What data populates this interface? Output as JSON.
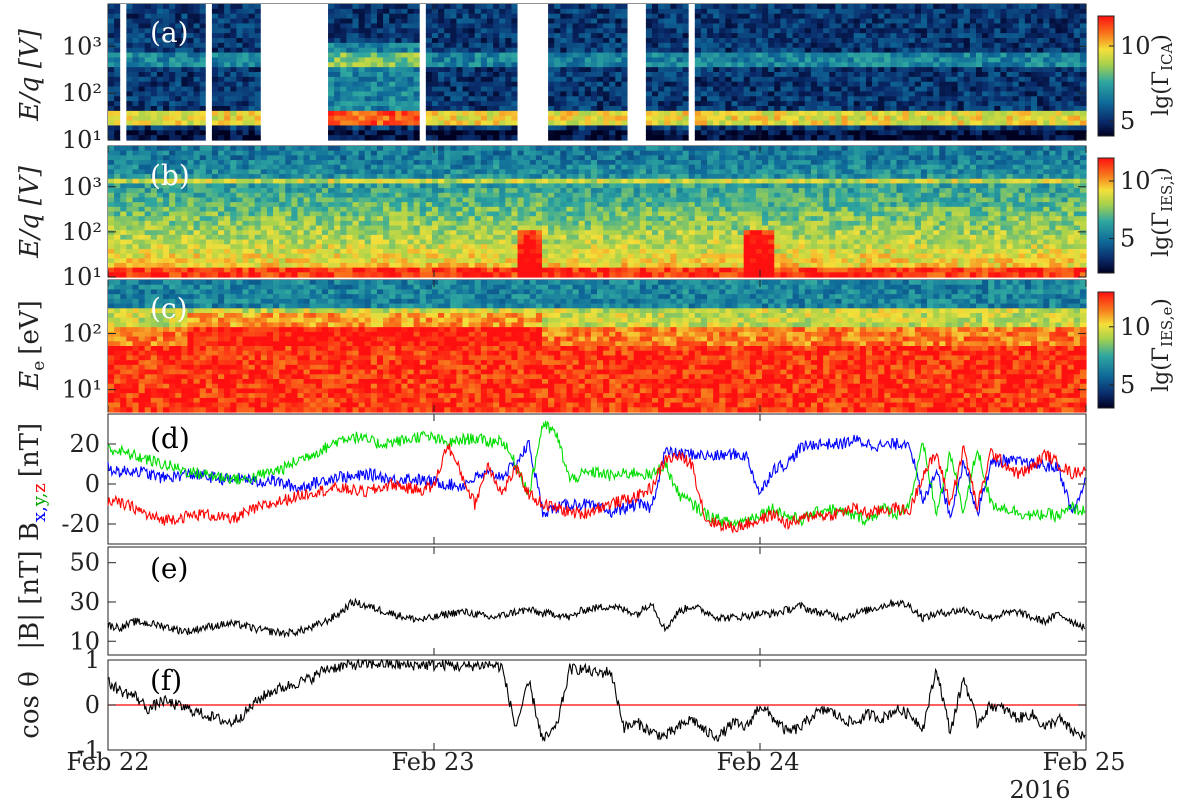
{
  "chart_data": [
    {
      "type": "heatmap",
      "panel": "(a)",
      "ylabel": "E/q [V]",
      "yscale": "log",
      "ylim": [
        10,
        8000
      ],
      "yticks": [
        "10¹",
        "10²",
        "10³"
      ],
      "colorbar": {
        "label": "lg(Γ_ICA)",
        "ticks": [
          "5",
          "10"
        ],
        "range": [
          4,
          12
        ],
        "colormap": "parula-jet"
      },
      "data_gaps_hours": [
        [
          0.8,
          1.25
        ],
        [
          7.05,
          7.5
        ],
        [
          11.2,
          16.0
        ],
        [
          23.05,
          23.3
        ],
        [
          30.0,
          32.5
        ],
        [
          38.2,
          39.4
        ],
        [
          42.6,
          43.0
        ]
      ]
    },
    {
      "type": "heatmap",
      "panel": "(b)",
      "ylabel": "E/q [V]",
      "yscale": "log",
      "ylim": [
        10,
        8000
      ],
      "yticks": [
        "10¹",
        "10²",
        "10³"
      ],
      "colorbar": {
        "label": "lg(Γ_IES,i)",
        "ticks": [
          "5",
          "10"
        ],
        "range": [
          2,
          12
        ],
        "colormap": "parula-jet"
      }
    },
    {
      "type": "heatmap",
      "panel": "(c)",
      "ylabel": "E_e [eV]",
      "yscale": "log",
      "ylim": [
        4,
        900
      ],
      "yticks": [
        "10¹",
        "10²"
      ],
      "colorbar": {
        "label": "lg(Γ_IES,e)",
        "ticks": [
          "5",
          "10"
        ],
        "range": [
          3,
          13
        ],
        "colormap": "parula-jet"
      }
    },
    {
      "type": "line",
      "panel": "(d)",
      "ylabel": "B_x,y,z [nT]",
      "ylim": [
        -30,
        35
      ],
      "yticks": [
        -20,
        0,
        20
      ],
      "series": [
        {
          "name": "x",
          "color": "#0000ff",
          "x": [
            0,
            1,
            2,
            3,
            4,
            5,
            6,
            7,
            8,
            9,
            10,
            11,
            12,
            13,
            14,
            15,
            16,
            17,
            18,
            19,
            20,
            21,
            22,
            23,
            24,
            25,
            26,
            27,
            28,
            29,
            30,
            31,
            32,
            33,
            34,
            35,
            36,
            37,
            38,
            39,
            40,
            41,
            42,
            43,
            44,
            45,
            46,
            47,
            48,
            49,
            50,
            51,
            52,
            53,
            54,
            55,
            56,
            57,
            58,
            59,
            60,
            61,
            62,
            63,
            64,
            65,
            66,
            67,
            68,
            69,
            70,
            71,
            72
          ],
          "y": [
            8,
            6,
            7,
            5,
            3,
            4,
            5,
            4,
            3,
            2,
            3,
            1,
            2,
            0,
            -2,
            0,
            2,
            4,
            3,
            5,
            4,
            2,
            3,
            2,
            1,
            0,
            -1,
            3,
            5,
            4,
            10,
            20,
            -14,
            -12,
            -10,
            -10,
            -12,
            -14,
            -12,
            -10,
            -12,
            16,
            15,
            15,
            14,
            14,
            15,
            14,
            -5,
            8,
            10,
            18,
            20,
            20,
            20,
            22,
            20,
            19,
            20,
            21,
            -10,
            8,
            -16,
            12,
            -15,
            10,
            12,
            11,
            10,
            9,
            8,
            -15,
            2
          ]
        },
        {
          "name": "y",
          "color": "#00dd00",
          "x": [
            0,
            1,
            2,
            3,
            4,
            5,
            6,
            7,
            8,
            9,
            10,
            11,
            12,
            13,
            14,
            15,
            16,
            17,
            18,
            19,
            20,
            21,
            22,
            23,
            24,
            25,
            26,
            27,
            28,
            29,
            30,
            31,
            32,
            33,
            34,
            35,
            36,
            37,
            38,
            39,
            40,
            41,
            42,
            43,
            44,
            45,
            46,
            47,
            48,
            49,
            50,
            51,
            52,
            53,
            54,
            55,
            56,
            57,
            58,
            59,
            60,
            61,
            62,
            63,
            64,
            65,
            66,
            67,
            68,
            69,
            70,
            71,
            72
          ],
          "y": [
            18,
            16,
            14,
            12,
            10,
            8,
            6,
            5,
            4,
            3,
            2,
            4,
            6,
            8,
            12,
            15,
            18,
            22,
            24,
            22,
            20,
            21,
            22,
            24,
            23,
            20,
            22,
            23,
            21,
            22,
            10,
            -5,
            30,
            25,
            2,
            5,
            6,
            4,
            5,
            6,
            4,
            10,
            -5,
            -10,
            -15,
            -18,
            -20,
            -18,
            -15,
            -12,
            -16,
            -18,
            -15,
            -12,
            -14,
            -16,
            -18,
            -12,
            -15,
            -10,
            20,
            -15,
            15,
            -14,
            18,
            -10,
            -12,
            -14,
            -16,
            -15,
            -16,
            -12,
            -14
          ]
        },
        {
          "name": "z",
          "color": "#ff0000",
          "x": [
            0,
            1,
            2,
            3,
            4,
            5,
            6,
            7,
            8,
            9,
            10,
            11,
            12,
            13,
            14,
            15,
            16,
            17,
            18,
            19,
            20,
            21,
            22,
            23,
            24,
            25,
            26,
            27,
            28,
            29,
            30,
            31,
            32,
            33,
            34,
            35,
            36,
            37,
            38,
            39,
            40,
            41,
            42,
            43,
            44,
            45,
            46,
            47,
            48,
            49,
            50,
            51,
            52,
            53,
            54,
            55,
            56,
            57,
            58,
            59,
            60,
            61,
            62,
            63,
            64,
            65,
            66,
            67,
            68,
            69,
            70,
            71,
            72
          ],
          "y": [
            -8,
            -10,
            -12,
            -16,
            -18,
            -17,
            -16,
            -15,
            -16,
            -18,
            -15,
            -12,
            -10,
            -8,
            -6,
            -4,
            -3,
            -2,
            -3,
            -4,
            -2,
            0,
            -2,
            -3,
            -1,
            20,
            5,
            -10,
            10,
            -5,
            8,
            -5,
            -10,
            -12,
            -14,
            -15,
            -12,
            -10,
            -8,
            -6,
            -2,
            12,
            14,
            10,
            -18,
            -20,
            -22,
            -20,
            -18,
            -15,
            -20,
            -18,
            -15,
            -16,
            -14,
            -12,
            -15,
            -13,
            -12,
            -14,
            5,
            15,
            -10,
            18,
            -12,
            16,
            10,
            5,
            8,
            15,
            10,
            5,
            8
          ]
        }
      ]
    },
    {
      "type": "line",
      "panel": "(e)",
      "ylabel": "|B| [nT]",
      "ylim": [
        3,
        58
      ],
      "yticks": [
        10,
        30,
        50
      ],
      "series": [
        {
          "name": "|B|",
          "color": "#000000",
          "x": [
            0,
            1,
            2,
            3,
            4,
            5,
            6,
            7,
            8,
            9,
            10,
            11,
            12,
            13,
            14,
            15,
            16,
            17,
            18,
            19,
            20,
            21,
            22,
            23,
            24,
            25,
            26,
            27,
            28,
            29,
            30,
            31,
            32,
            33,
            34,
            35,
            36,
            37,
            38,
            39,
            40,
            41,
            42,
            43,
            44,
            45,
            46,
            47,
            48,
            49,
            50,
            51,
            52,
            53,
            54,
            55,
            56,
            57,
            58,
            59,
            60,
            61,
            62,
            63,
            64,
            65,
            66,
            67,
            68,
            69,
            70,
            71,
            72
          ],
          "y": [
            18,
            17,
            20,
            19,
            18,
            16,
            15,
            17,
            18,
            19,
            18,
            16,
            15,
            14,
            15,
            17,
            20,
            24,
            30,
            28,
            26,
            24,
            22,
            21,
            22,
            24,
            25,
            24,
            22,
            23,
            25,
            26,
            24,
            24,
            22,
            26,
            27,
            28,
            26,
            24,
            30,
            16,
            25,
            28,
            25,
            22,
            22,
            23,
            24,
            24,
            26,
            28,
            25,
            24,
            22,
            24,
            26,
            28,
            30,
            28,
            22,
            24,
            25,
            26,
            24,
            22,
            24,
            25,
            22,
            20,
            24,
            20,
            17
          ]
        }
      ]
    },
    {
      "type": "line",
      "panel": "(f)",
      "ylabel": "cos θ",
      "ylim": [
        -1,
        1
      ],
      "yticks": [
        -1,
        0,
        1
      ],
      "reference_line": {
        "y": 0,
        "color": "#ff0000"
      },
      "series": [
        {
          "name": "cos θ",
          "color": "#000000",
          "x": [
            0,
            1,
            2,
            3,
            4,
            5,
            6,
            7,
            8,
            9,
            10,
            11,
            12,
            13,
            14,
            15,
            16,
            17,
            18,
            19,
            20,
            21,
            22,
            23,
            24,
            25,
            26,
            27,
            28,
            29,
            30,
            31,
            32,
            33,
            34,
            35,
            36,
            37,
            38,
            39,
            40,
            41,
            42,
            43,
            44,
            45,
            46,
            47,
            48,
            49,
            50,
            51,
            52,
            53,
            54,
            55,
            56,
            57,
            58,
            59,
            60,
            61,
            62,
            63,
            64,
            65,
            66,
            67,
            68,
            69,
            70,
            71,
            72
          ],
          "y": [
            0.5,
            0.3,
            0.2,
            -0.1,
            0.1,
            0.0,
            -0.1,
            -0.2,
            -0.3,
            -0.4,
            -0.2,
            0.1,
            0.3,
            0.4,
            0.5,
            0.6,
            0.8,
            0.85,
            0.9,
            0.9,
            0.92,
            0.9,
            0.88,
            0.9,
            0.88,
            0.9,
            0.85,
            0.88,
            0.9,
            0.85,
            -0.5,
            0.5,
            -0.8,
            -0.5,
            0.8,
            0.8,
            0.7,
            0.75,
            -0.5,
            -0.4,
            -0.6,
            -0.7,
            -0.5,
            -0.3,
            -0.6,
            -0.7,
            -0.4,
            -0.5,
            0.0,
            -0.3,
            -0.6,
            -0.5,
            -0.2,
            -0.1,
            -0.3,
            -0.4,
            -0.2,
            -0.3,
            -0.1,
            -0.2,
            -0.5,
            0.8,
            -0.6,
            0.6,
            -0.4,
            0.0,
            -0.1,
            -0.3,
            -0.2,
            -0.5,
            -0.3,
            -0.6,
            -0.7
          ]
        }
      ]
    }
  ],
  "x_axis": {
    "tick_labels": [
      "Feb 22",
      "Feb 23",
      "Feb 24",
      "Feb 25"
    ],
    "tick_hours": [
      0,
      24,
      48,
      72
    ],
    "year_label": "2016",
    "range_hours": [
      0,
      72
    ]
  },
  "panel_labels": [
    "(a)",
    "(b)",
    "(c)",
    "(d)",
    "(e)",
    "(f)"
  ],
  "axis_labels": {
    "a": "E/q [V]",
    "b": "E/q [V]",
    "c_main": "E",
    "c_sub": "e",
    "c_unit": "[eV]",
    "d_main": "B",
    "d_sub_x": "x,",
    "d_sub_y": "y,",
    "d_sub_z": "z",
    "d_unit": "[nT]",
    "e": "|B| [nT]",
    "f": "cos θ"
  },
  "colorbar_labels": {
    "a_main": "lg(Γ",
    "a_sub": "ICA",
    "b_main": "lg(Γ",
    "b_sub": "IES,i",
    "c_main": "lg(Γ",
    "c_sub": "IES,e",
    "close": ")"
  },
  "colors": {
    "bx": "#0000ff",
    "by": "#00dd00",
    "bz": "#ff0000",
    "line": "#000000",
    "zero": "#ff0000"
  }
}
